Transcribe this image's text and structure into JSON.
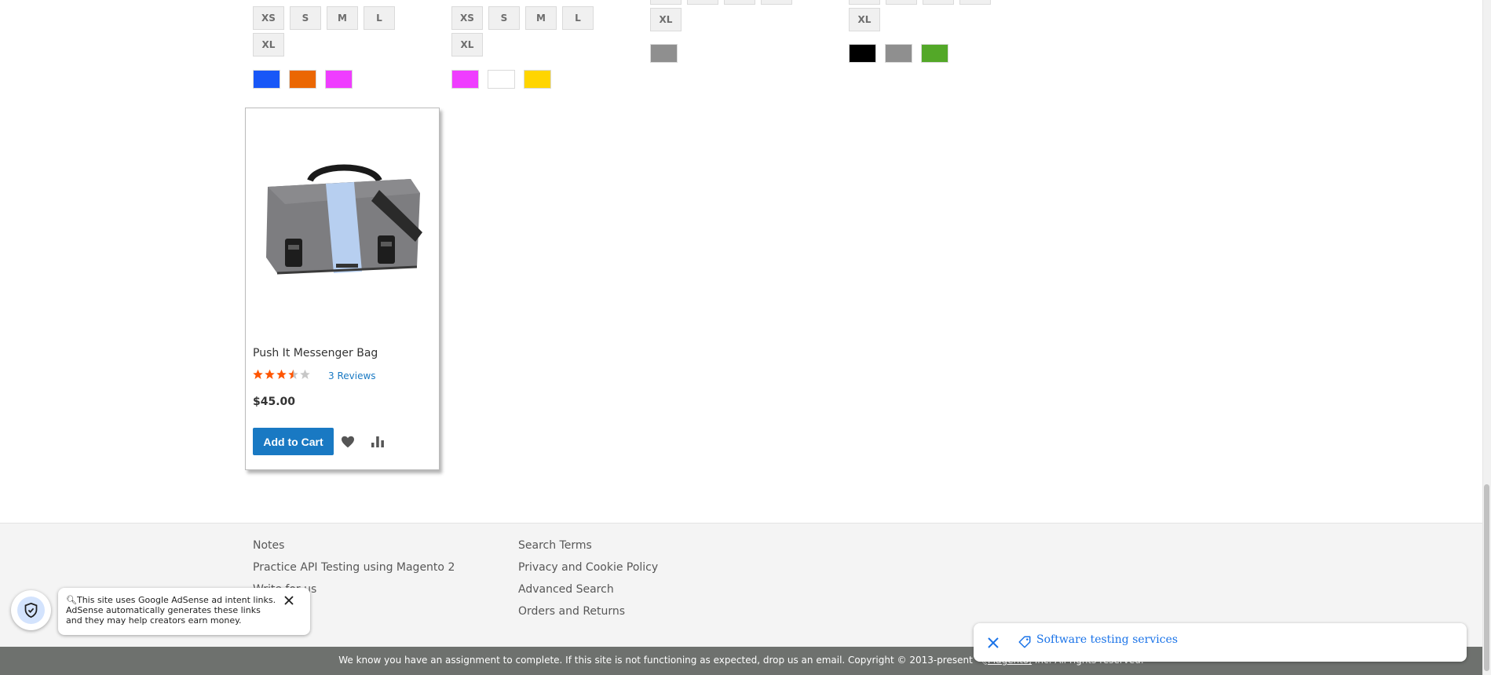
{
  "products_above": [
    {
      "sizes_row1": [
        "XS",
        "S",
        "M",
        "L"
      ],
      "sizes_row2": [
        "XL"
      ],
      "colors": [
        "#1857f7",
        "#eb6703",
        "#ef3dff"
      ]
    },
    {
      "sizes_row1": [
        "XS",
        "S",
        "M",
        "L"
      ],
      "sizes_row2": [
        "XL"
      ],
      "colors": [
        "#ef3dff",
        "#ffffff",
        "#ffd500"
      ]
    },
    {
      "sizes_row2": [
        "XL"
      ],
      "colors": [
        "#8f8f8f"
      ]
    },
    {
      "sizes_row2": [
        "XL"
      ],
      "colors": [
        "#000000",
        "#8f8f8f",
        "#53a828"
      ]
    }
  ],
  "product": {
    "name": "Push It Messenger Bag",
    "rating_percent": 66,
    "reviews_label": "3 Reviews",
    "price": "$45.00",
    "add_to_cart_label": "Add to Cart",
    "wishlist_icon": "heart-icon",
    "compare_icon": "bar-chart-icon"
  },
  "footer": {
    "col1": [
      "Notes",
      "Practice API Testing using Magento 2",
      "Write for us"
    ],
    "col2": [
      "Search Terms",
      "Privacy and Cookie Policy",
      "Advanced Search",
      "Orders and Returns"
    ],
    "copyright_text": "We know you have an assignment to complete. If this site is not functioning as expected, drop us an email. Copyright © 2013-present",
    "copyright_brand": "Magento,",
    "copyright_tail": " Inc. All rights reserved."
  },
  "adsense_notice": {
    "text": "This site uses Google AdSense ad intent links. AdSense automatically generates these links and they may help creators earn money."
  },
  "intent_bar": {
    "text": "Software testing services"
  },
  "colors": {
    "primary": "#1979c3",
    "rating": "#ff5501",
    "footer_bg": "#f4f4f4",
    "copyright_bg": "#6e716e"
  }
}
